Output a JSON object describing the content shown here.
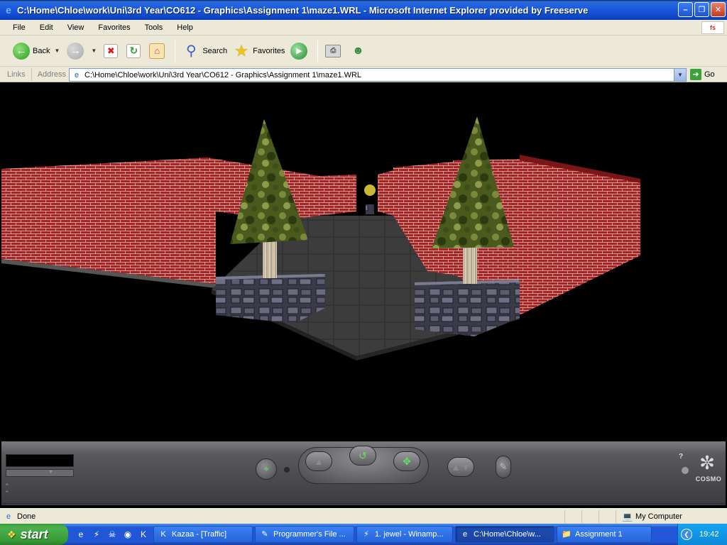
{
  "window": {
    "title": "C:\\Home\\Chloe\\work\\Uni\\3rd Year\\CO612 - Graphics\\Assignment 1\\maze1.WRL - Microsoft Internet Explorer provided by Freeserve",
    "minimize_glyph": "–",
    "maximize_glyph": "❐",
    "close_glyph": "✕"
  },
  "menu": {
    "items": [
      "File",
      "Edit",
      "View",
      "Favorites",
      "Tools",
      "Help"
    ]
  },
  "toolbar": {
    "back_label": "Back",
    "search_label": "Search",
    "favorites_label": "Favorites"
  },
  "address": {
    "links_label": "Links",
    "address_label": "Address",
    "value": "C:\\Home\\Chloe\\work\\Uni\\3rd Year\\CO612 - Graphics\\Assignment 1\\maze1.WRL",
    "go_label": "Go"
  },
  "cosmo": {
    "logo_text": "COSMO",
    "help_glyph": "?"
  },
  "status": {
    "text": "Done",
    "zone": "My Computer"
  },
  "taskbar": {
    "start_label": "start",
    "tasks": [
      {
        "label": "Kazaa - [Traffic]",
        "icon": "kazaa-icon"
      },
      {
        "label": "Programmer's File ...",
        "icon": "editor-icon"
      },
      {
        "label": "1. jewel - Winamp...",
        "icon": "winamp-icon"
      },
      {
        "label": "C:\\Home\\Chloe\\w...",
        "icon": "ie-icon"
      },
      {
        "label": "Assignment 1",
        "icon": "folder-icon"
      }
    ],
    "clock": "19:42"
  },
  "colors": {
    "title_blue": "#0d47c8",
    "chrome": "#ece9d8",
    "brick_red": "#9c1c1c",
    "floor_gray": "#3a3a3a",
    "tree_green": "#5a6b22"
  }
}
